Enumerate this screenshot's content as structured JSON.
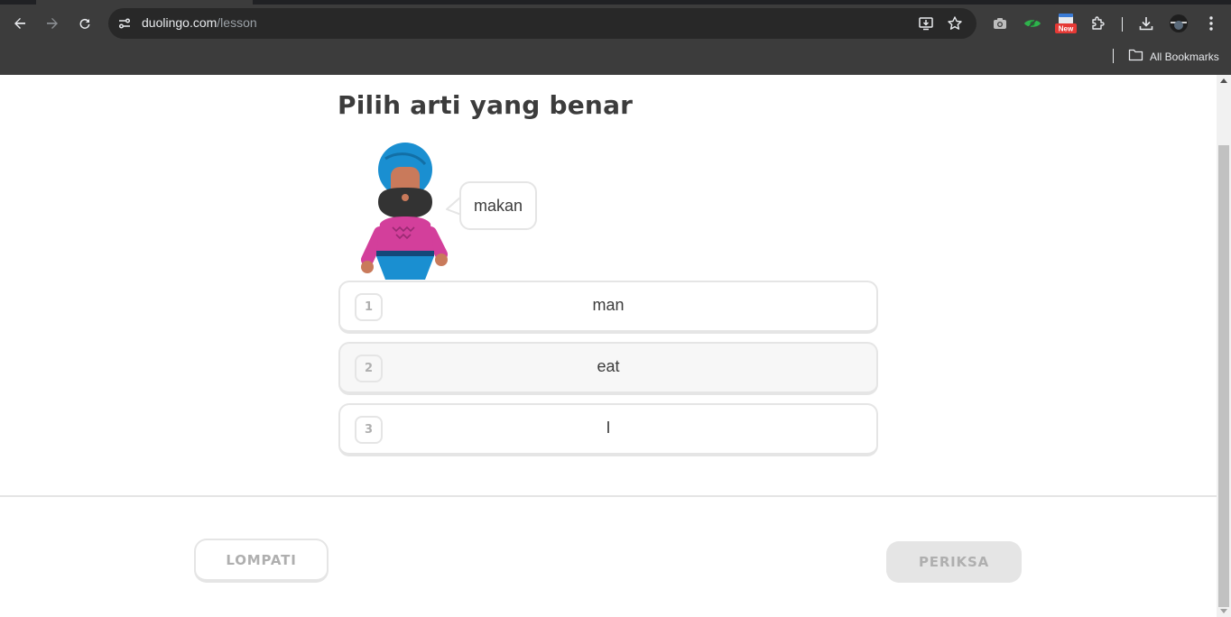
{
  "browser": {
    "url_host": "duolingo.com",
    "url_path": "/lesson",
    "extension_badge": "New",
    "bookmarks_label": "All Bookmarks",
    "icons": [
      "back-icon",
      "forward-icon",
      "reload-icon",
      "site-info-icon",
      "install-app-icon",
      "bookmark-star-icon",
      "camera-extension-icon",
      "eye-extension-icon",
      "new-badge-extension-icon",
      "extensions-puzzle-icon",
      "download-icon",
      "profile-avatar",
      "menu-kebab-icon",
      "folder-icon"
    ]
  },
  "lesson": {
    "title": "Pilih arti yang benar",
    "speech": "makan",
    "options": [
      {
        "num": "1",
        "label": "man"
      },
      {
        "num": "2",
        "label": "eat"
      },
      {
        "num": "3",
        "label": "I"
      }
    ],
    "skip_label": "LOMPATI",
    "check_label": "PERIKSA"
  },
  "colors": {
    "chrome_bg": "#3c3c3c",
    "omnibox_bg": "#282828",
    "border": "#e5e5e5",
    "text": "#3c3c3c",
    "muted": "#afafaf",
    "hover_bg": "#f7f7f7"
  }
}
